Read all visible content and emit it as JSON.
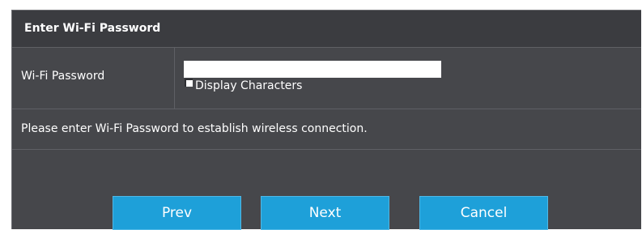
{
  "section": {
    "title": "Enter Wi-Fi Password"
  },
  "password_row": {
    "label": "Wi-Fi Password",
    "value": "",
    "display_characters_label": "Display Characters",
    "display_characters_checked": false
  },
  "info": {
    "message": "Please enter Wi-Fi Password to establish wireless connection."
  },
  "buttons": {
    "prev": "Prev",
    "next": "Next",
    "cancel": "Cancel"
  },
  "colors": {
    "panel_bg": "#46474b",
    "header_bg": "#3b3c40",
    "button_bg": "#1ea0d9",
    "text": "#ffffff"
  }
}
